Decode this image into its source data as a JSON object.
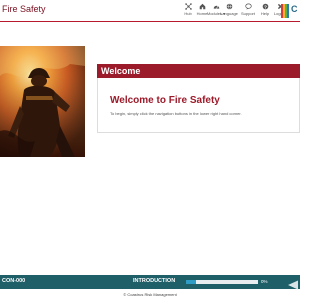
{
  "header": {
    "title": "Fire Safety",
    "nav": [
      {
        "label": "Hub",
        "icon": "hub-icon"
      },
      {
        "label": "Home",
        "icon": "home-icon"
      },
      {
        "label": "Modules ▾",
        "icon": "modules-icon"
      },
      {
        "label": "Language",
        "icon": "language-icon"
      },
      {
        "label": "Support",
        "icon": "support-icon"
      },
      {
        "label": "Help",
        "icon": "help-icon"
      },
      {
        "label": "Logout",
        "icon": "logout-icon"
      }
    ],
    "brand_letter": "C",
    "brand_colors": [
      "#e03a2f",
      "#f1b52d",
      "#5bb04a",
      "#2d7ab8"
    ]
  },
  "hero": {
    "image": "firefighter-in-flames-photo"
  },
  "welcome": {
    "bar_title": "Welcome",
    "heading": "Welcome to Fire Safety",
    "instructions": "To begin, simply click the navigation buttons in the lower right hand corner."
  },
  "footer": {
    "code": "CON-000",
    "section": "INTRODUCTION",
    "progress": 0.14,
    "progress_text": "0%",
    "back_icon": "back-arrow-icon"
  },
  "copyright": "© Coastrus Risk Management",
  "colors": {
    "accent": "#9c1b2b",
    "footer": "#1f5f68",
    "progress": "#2e9cc4"
  }
}
